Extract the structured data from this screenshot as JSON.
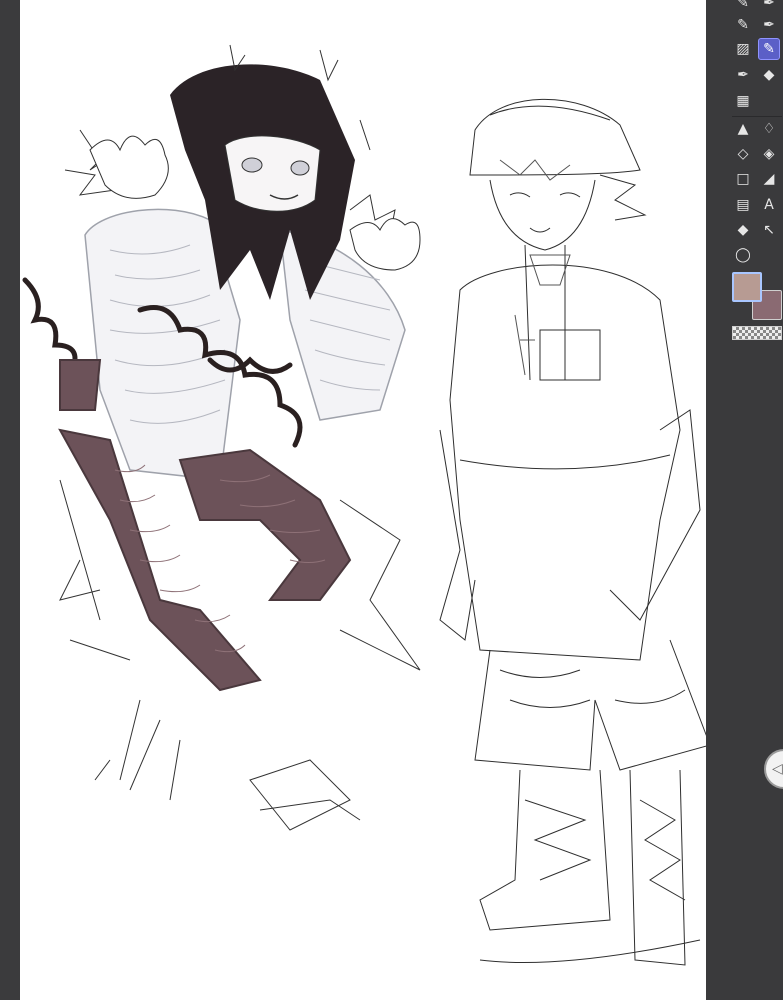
{
  "app": {
    "colors": {
      "workspace": "#2e2e30",
      "canvas": "#ffffff",
      "panel": "#3a3a3c",
      "accent": "#5b5fc7",
      "main_color": "#b79b93",
      "sub_color": "#8a6a72"
    }
  },
  "toolbar": {
    "tools": [
      {
        "id": "pencil",
        "icon": "pencil-icon",
        "glyph": "✎",
        "active": false
      },
      {
        "id": "pen",
        "icon": "pen-icon",
        "glyph": "✒",
        "active": false
      },
      {
        "id": "gradient",
        "icon": "gradient-icon",
        "glyph": "▨",
        "active": false
      },
      {
        "id": "g-pen",
        "icon": "g-pen-icon",
        "glyph": "✎",
        "active": true
      },
      {
        "id": "fountain-pen",
        "icon": "fountain-pen-icon",
        "glyph": "✒",
        "active": false
      },
      {
        "id": "marker",
        "icon": "marker-icon",
        "glyph": "◆",
        "active": false
      },
      {
        "id": "pattern",
        "icon": "pattern-icon",
        "glyph": "▦",
        "active": false
      },
      {
        "id": "fill-bucket",
        "icon": "bucket-icon",
        "glyph": "▲",
        "active": false
      },
      {
        "id": "water-drop",
        "icon": "water-drop-icon",
        "glyph": "💧",
        "active": false
      },
      {
        "id": "eraser",
        "icon": "eraser-icon",
        "glyph": "◇",
        "active": false
      },
      {
        "id": "paint-fill",
        "icon": "paint-fill-icon",
        "glyph": "◈",
        "active": false
      },
      {
        "id": "rectangle",
        "icon": "rectangle-icon",
        "glyph": "□",
        "active": false
      },
      {
        "id": "ruler",
        "icon": "ruler-icon",
        "glyph": "◢",
        "active": false
      },
      {
        "id": "frame",
        "icon": "frame-icon",
        "glyph": "▤",
        "active": false
      },
      {
        "id": "text",
        "icon": "text-icon",
        "glyph": "A",
        "active": false
      },
      {
        "id": "eraser2",
        "icon": "eraser-2-icon",
        "glyph": "◆",
        "active": false
      },
      {
        "id": "select-move",
        "icon": "select-move-icon",
        "glyph": "↖",
        "active": false
      },
      {
        "id": "lasso",
        "icon": "lasso-icon",
        "glyph": "◯",
        "active": false
      }
    ],
    "toggle_icon": "chevron-left-icon"
  }
}
